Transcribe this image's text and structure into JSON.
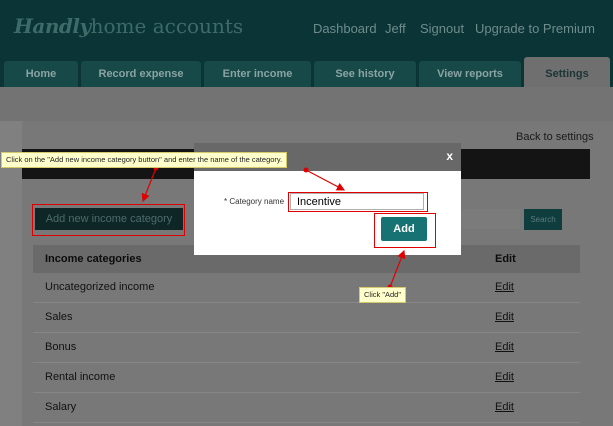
{
  "header": {
    "logo_script": "Handly",
    "logo_text": "home accounts",
    "nav": [
      "Dashboard",
      "Jeff",
      "Signout",
      "Upgrade to Premium"
    ]
  },
  "tabs": [
    "Home",
    "Record expense",
    "Enter income",
    "See history",
    "View reports",
    "Settings"
  ],
  "active_tab": "Settings",
  "page": {
    "back_link": "Back to settings",
    "add_category_button": "Add new income category",
    "search_button": "Search"
  },
  "table": {
    "headers": [
      "Income categories",
      "Edit"
    ],
    "rows": [
      {
        "name": "Uncategorized income",
        "edit": "Edit"
      },
      {
        "name": "Sales",
        "edit": "Edit"
      },
      {
        "name": "Bonus",
        "edit": "Edit"
      },
      {
        "name": "Rental income",
        "edit": "Edit"
      },
      {
        "name": "Salary",
        "edit": "Edit"
      }
    ]
  },
  "modal": {
    "close": "x",
    "field_label": "* Category name",
    "field_value": "Incentive",
    "add_button": "Add"
  },
  "annotations": {
    "callout_1": "Click on the \"Add new income category button\" and enter the name of the category.",
    "callout_2": "Click \"Add\""
  },
  "colors": {
    "header_bg": "#0a3436",
    "accent": "#177373",
    "highlight": "#e00000",
    "callout_bg": "#ffffcc"
  }
}
